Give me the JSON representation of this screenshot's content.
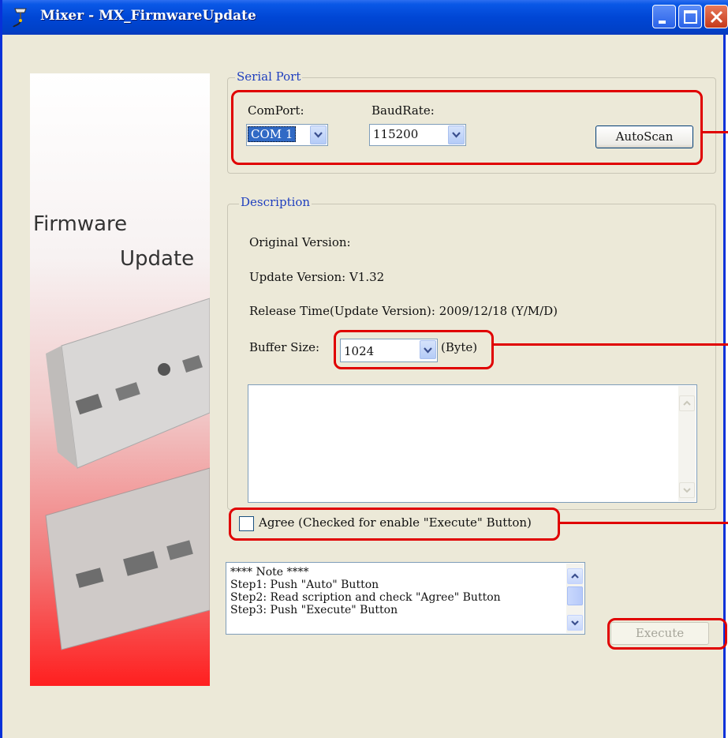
{
  "window": {
    "title": "Mixer - MX_FirmwareUpdate"
  },
  "banner": {
    "line1": "Firmware",
    "line2": "Update"
  },
  "serial_port": {
    "legend": "Serial Port",
    "comport_label": "ComPort:",
    "comport_value": "COM 1",
    "baudrate_label": "BaudRate:",
    "baudrate_value": "115200",
    "autoscan_label": "AutoScan"
  },
  "description": {
    "legend": "Description",
    "original_version": "Original Version:",
    "update_version": "Update Version: V1.32",
    "release_time": "Release Time(Update Version): 2009/12/18 (Y/M/D)",
    "buffer_size_label": "Buffer Size:",
    "buffer_size_value": "1024",
    "buffer_unit": "(Byte)"
  },
  "agree": {
    "label": "Agree (Checked for enable \"Execute\" Button)",
    "checked": false
  },
  "notes": {
    "lines": [
      "**** Note ****",
      "Step1: Push \"Auto\" Button",
      "Step2: Read scription and check \"Agree\" Button",
      "Step3: Push \"Execute\" Button"
    ]
  },
  "execute": {
    "label": "Execute",
    "enabled": false
  },
  "colors": {
    "highlight_red": "#e00000",
    "title_blue": "#0046d5",
    "legend_blue": "#1f3fbf"
  }
}
